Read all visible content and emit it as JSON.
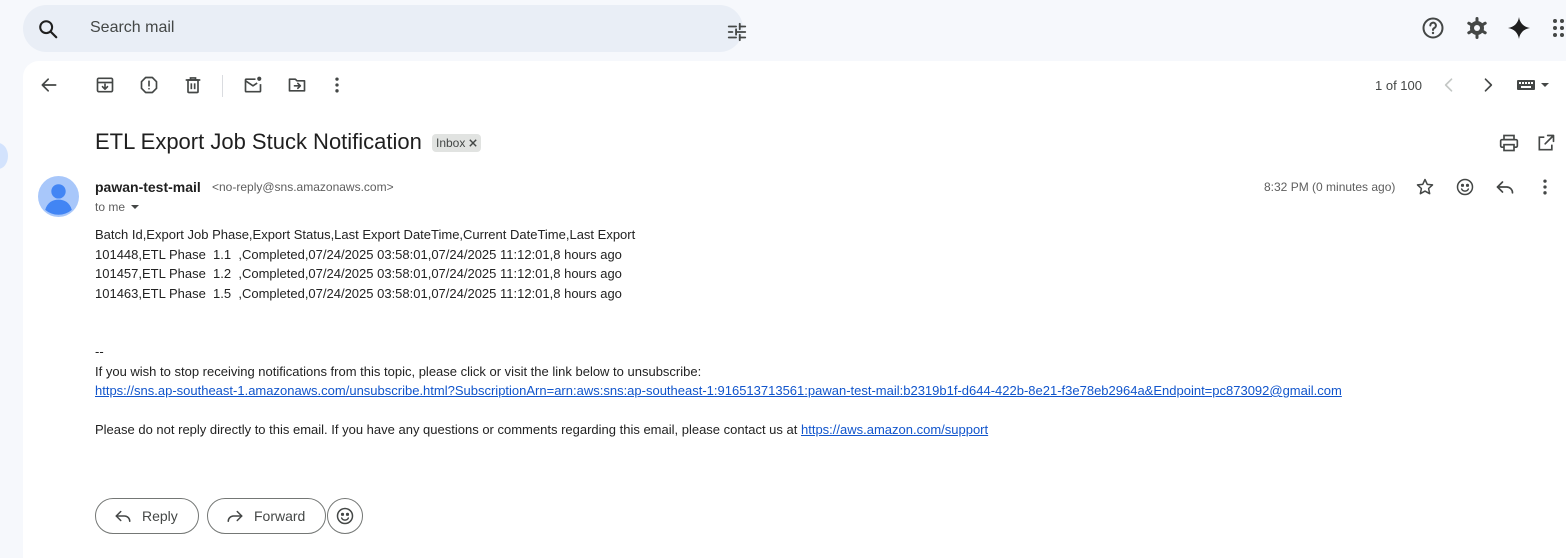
{
  "search": {
    "placeholder": "Search mail"
  },
  "toolbar": {
    "back_icon": "arrow-back-icon",
    "archive_icon": "archive-icon",
    "spam_icon": "report-spam-icon",
    "delete_icon": "delete-icon",
    "mark_unread_icon": "mark-unread-icon",
    "move_icon": "move-to-icon",
    "more_icon": "more-vert-icon",
    "pager": "1 of 100"
  },
  "header_icons": [
    "help-icon",
    "settings-icon",
    "gemini-icon",
    "apps-icon"
  ],
  "email": {
    "subject": "ETL Export Job Stuck Notification",
    "label_chip": "Inbox",
    "sender_name": "pawan-test-mail",
    "sender_email": "<no-reply@sns.amazonaws.com>",
    "recipient": "to me",
    "timestamp": "8:32 PM (0 minutes ago)",
    "body": {
      "csv_header": "Batch Id,Export Job Phase,Export Status,Last Export DateTime,Current DateTime,Last Export",
      "rows": [
        "101448,ETL Phase  1.1  ,Completed,07/24/2025 03:58:01,07/24/2025 11:12:01,8 hours ago",
        "101457,ETL Phase  1.2  ,Completed,07/24/2025 03:58:01,07/24/2025 11:12:01,8 hours ago",
        "101463,ETL Phase  1.5  ,Completed,07/24/2025 03:58:01,07/24/2025 11:12:01,8 hours ago"
      ],
      "signature_sep": "--",
      "unsubscribe_text": "If you wish to stop receiving notifications from this topic, please click or visit the link below to unsubscribe:",
      "unsubscribe_link": "https://sns.ap-southeast-1.amazonaws.com/unsubscribe.html?SubscriptionArn=arn:aws:sns:ap-southeast-1:916513713561:pawan-test-mail:b2319b1f-d644-422b-8e21-f3e78eb2964a&Endpoint=pc873092@gmail.com",
      "footer_text": "Please do not reply directly to this email. If you have any questions or comments regarding this email, please contact us at ",
      "footer_link": "https://aws.amazon.com/support"
    }
  },
  "actions": {
    "reply_label": "Reply",
    "forward_label": "Forward"
  },
  "colors": {
    "link": "#1155cc",
    "background": "#f6f8fc",
    "search_bg": "#e9eef6",
    "avatar": "#4285f4"
  }
}
